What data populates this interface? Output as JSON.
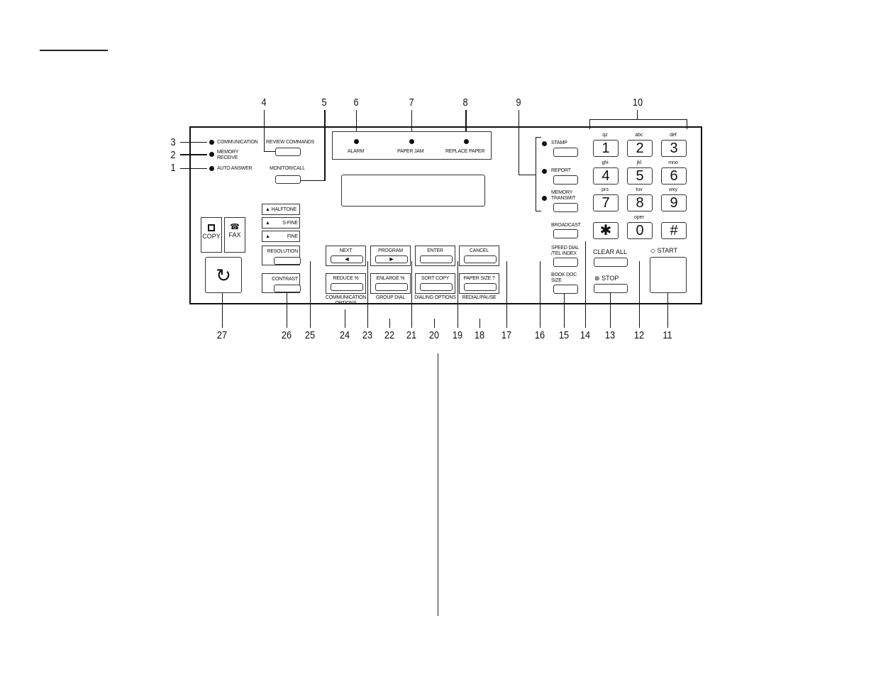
{
  "callouts": [
    "1",
    "2",
    "3",
    "4",
    "5",
    "6",
    "7",
    "8",
    "9",
    "10",
    "11",
    "12",
    "13",
    "14",
    "15",
    "16",
    "17",
    "18",
    "19",
    "20",
    "21",
    "22",
    "23",
    "24",
    "25",
    "26",
    "27"
  ],
  "status_leds": [
    {
      "label": "COMMUNICATION"
    },
    {
      "label": "MEMORY\nRECEIVE",
      "l1": "MEMORY",
      "l2": "RECEIVE"
    },
    {
      "label": "AUTO ANSWER"
    }
  ],
  "top_buttons": {
    "review": "REVIEW COMMANDS",
    "monitor": "MONITOR/CALL"
  },
  "alerts": [
    {
      "label": "ALARM"
    },
    {
      "label": "PAPER JAM"
    },
    {
      "label": "REPLACE PAPER"
    }
  ],
  "side_leds": [
    {
      "label": "STAMP"
    },
    {
      "label": "REPORT"
    },
    {
      "l1": "MEMORY",
      "l2": "TRANSMIT"
    }
  ],
  "keypad": [
    {
      "key": "1",
      "sub": "qz"
    },
    {
      "key": "2",
      "sub": "abc"
    },
    {
      "key": "3",
      "sub": "def"
    },
    {
      "key": "4",
      "sub": "ghi"
    },
    {
      "key": "5",
      "sub": "jkl"
    },
    {
      "key": "6",
      "sub": "mno"
    },
    {
      "key": "7",
      "sub": "prs"
    },
    {
      "key": "8",
      "sub": "tuv"
    },
    {
      "key": "9",
      "sub": "wxy"
    },
    {
      "key": "✱",
      "sub": ""
    },
    {
      "key": "0",
      "sub": "oper"
    },
    {
      "key": "#",
      "sub": ""
    }
  ],
  "right_buttons": {
    "broadcast": "BROADCAST",
    "speed1": "SPEED DIAL",
    "speed2": "/TEL INDEX",
    "book1": "BOOK DOC",
    "book2": "SIZE",
    "clear_all": "CLEAR ALL",
    "stop": "STOP",
    "start": "START"
  },
  "resolution": {
    "halftone": "HALFTONE",
    "sfine": "S-FINE",
    "fine": "FINE",
    "resolution": "RESOLUTION",
    "contrast": "CONTRAST"
  },
  "mode": {
    "copy": "COPY",
    "fax": "FAX"
  },
  "function_keys": {
    "row1": [
      "NEXT",
      "PROGRAM",
      "ENTER",
      "CANCEL"
    ],
    "row2": [
      "REDUCE %",
      "ENLARGE %",
      "SORT COPY",
      "PAPER SIZE ?"
    ],
    "below": [
      "COMMUNICATION",
      "GROUP DIAL",
      "DIALING OPTIONS",
      "REDIAL/PAUSE"
    ],
    "below2": "OPTIONS"
  }
}
